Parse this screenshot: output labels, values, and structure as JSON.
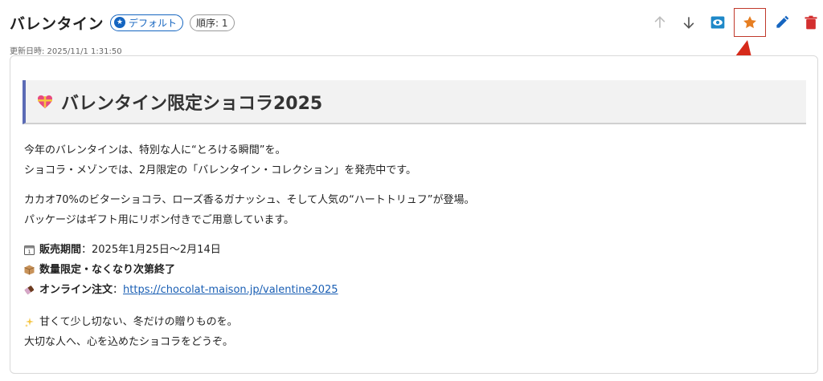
{
  "header": {
    "title": "バレンタイン",
    "default_badge": "デフォルト",
    "order_badge": "順序: 1",
    "updated": "更新日時: 2025/11/1 1:31:50"
  },
  "toolbar": {
    "move_up_icon": "arrow-up-icon",
    "move_down_icon": "arrow-down-icon",
    "preview_icon": "eye-icon",
    "default_icon": "star-icon",
    "edit_icon": "pencil-icon",
    "delete_icon": "trash-icon"
  },
  "colors": {
    "accent_blue": "#1565c0",
    "star_orange": "#e67e22",
    "delete_red": "#d32f2f",
    "highlight_red": "#c0392b",
    "heading_bar": "#5b6bb5"
  },
  "content": {
    "heading": "バレンタイン限定ショコラ2025",
    "intro_line1": "今年のバレンタインは、特別な人に“とろける瞬間”を。",
    "intro_line2": "ショコラ・メゾンでは、2月限定の「バレンタイン・コレクション」を発売中です。",
    "desc_line1": "カカオ70%のビターショコラ、ローズ香るガナッシュ、そして人気の“ハートトリュフ”が登場。",
    "desc_line2": "パッケージはギフト用にリボン付きでご用意しています。",
    "period_label": "販売期間",
    "period_value": "：2025年1月25日〜2月14日",
    "limited_label": "数量限定・なくなり次第終了",
    "order_label": "オンライン注文",
    "order_sep": "：",
    "order_url": "https://chocolat-maison.jp/valentine2025",
    "closing_line1": "甘くて少し切ない、冬だけの贈りものを。",
    "closing_line2": "大切な人へ、心を込めたショコラをどうぞ。"
  }
}
